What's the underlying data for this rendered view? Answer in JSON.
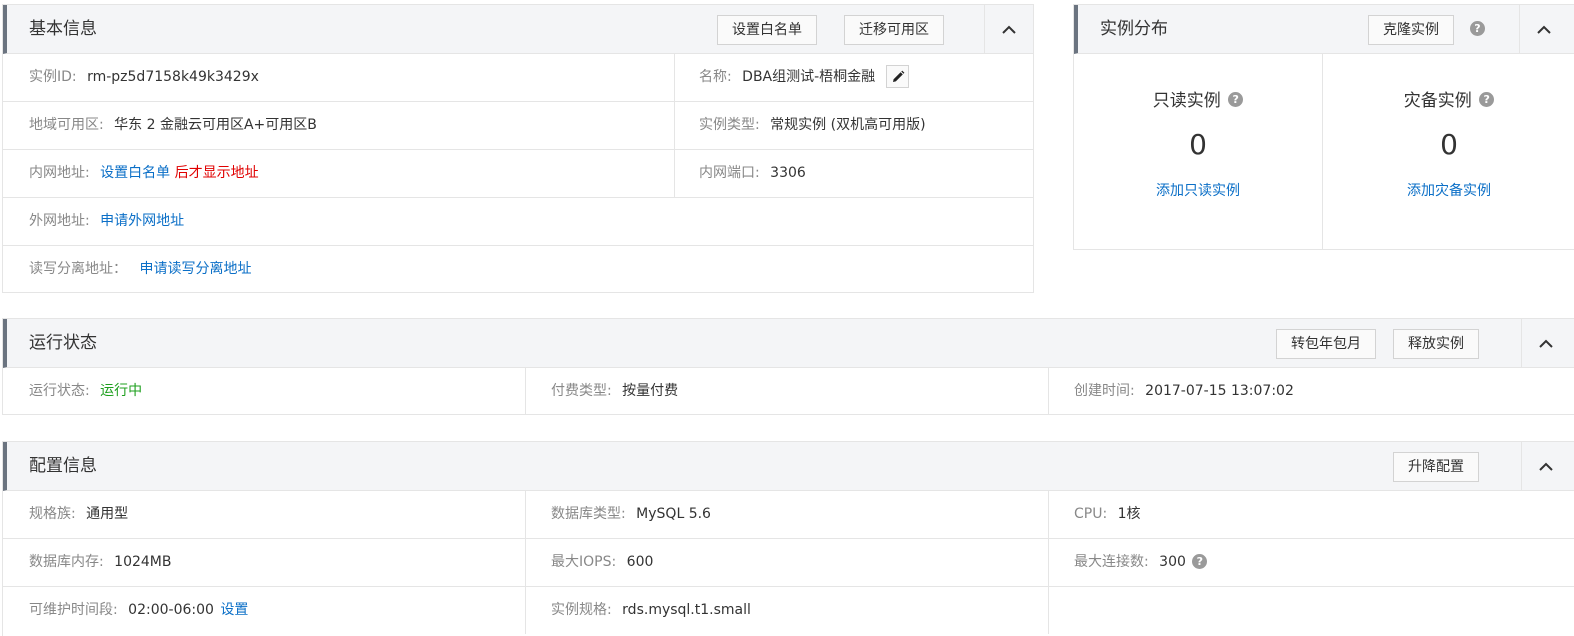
{
  "basic": {
    "title": "基本信息",
    "btn_whitelist": "设置白名单",
    "btn_migrate": "迁移可用区",
    "instance_id_label": "实例ID:",
    "instance_id_value": "rm-pz5d7158k49k3429x",
    "name_label": "名称:",
    "name_value": "DBA组测试-梧桐金融",
    "region_label": "地域可用区:",
    "region_value": "华东 2 金融云可用区A+可用区B",
    "type_label": "实例类型:",
    "type_value": "常规实例 (双机高可用版)",
    "intranet_label": "内网地址:",
    "intranet_link": "设置白名单",
    "intranet_note": "后才显示地址",
    "port_label": "内网端口:",
    "port_value": "3306",
    "extranet_label": "外网地址:",
    "extranet_link": "申请外网地址",
    "rw_label": "读写分离地址：",
    "rw_link": "申请读写分离地址"
  },
  "distribution": {
    "title": "实例分布",
    "btn_clone": "克隆实例",
    "readonly_title": "只读实例",
    "readonly_count": "0",
    "readonly_link": "添加只读实例",
    "disaster_title": "灾备实例",
    "disaster_count": "0",
    "disaster_link": "添加灾备实例"
  },
  "status": {
    "title": "运行状态",
    "btn_subscribe": "转包年包月",
    "btn_release": "释放实例",
    "run_label": "运行状态:",
    "run_value": "运行中",
    "pay_label": "付费类型:",
    "pay_value": "按量付费",
    "created_label": "创建时间:",
    "created_value": "2017-07-15 13:07:02"
  },
  "config": {
    "title": "配置信息",
    "btn_upgrade": "升降配置",
    "family_label": "规格族:",
    "family_value": "通用型",
    "dbtype_label": "数据库类型:",
    "dbtype_value": "MySQL 5.6",
    "cpu_label": "CPU:",
    "cpu_value": "1核",
    "mem_label": "数据库内存:",
    "mem_value": "1024MB",
    "iops_label": "最大IOPS:",
    "iops_value": "600",
    "conn_label": "最大连接数:",
    "conn_value": "300",
    "maint_label": "可维护时间段:",
    "maint_value": "02:00-06:00",
    "maint_link": "设置",
    "spec_label": "实例规格:",
    "spec_value": "rds.mysql.t1.small"
  },
  "icons": {
    "help": "?",
    "help_color": "#9a9a9a"
  },
  "colors": {
    "link": "#0b6fc7",
    "danger": "#e00000",
    "success": "#1e9f1e",
    "header_bg": "#f4f5f7"
  }
}
